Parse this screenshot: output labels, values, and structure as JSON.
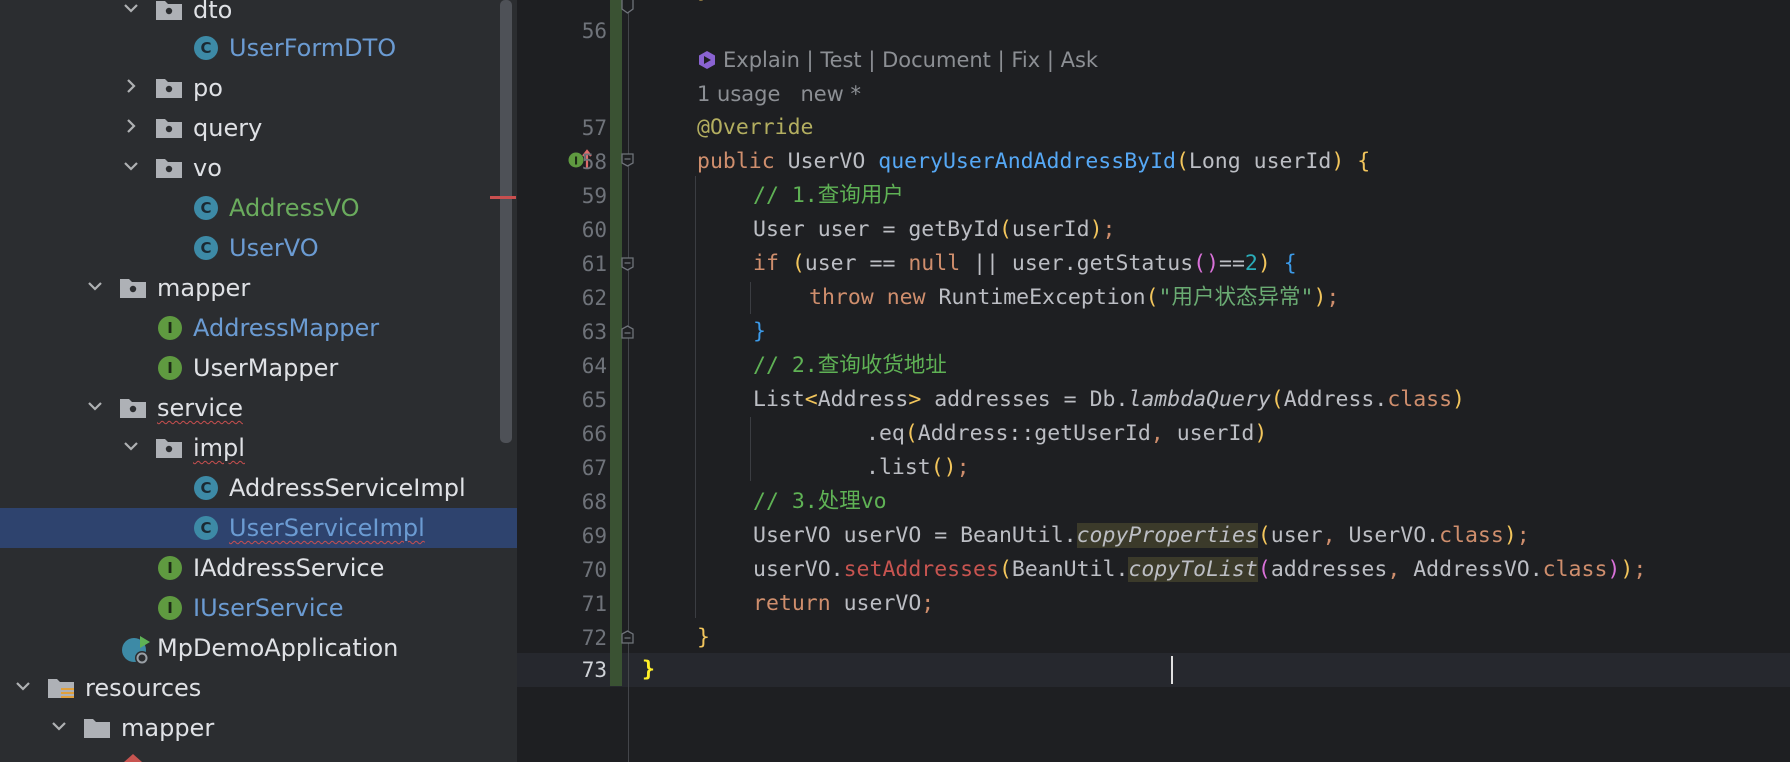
{
  "project_tree": {
    "items": [
      {
        "label": "dto",
        "kind": "package"
      },
      {
        "label": "UserFormDTO",
        "kind": "class"
      },
      {
        "label": "po",
        "kind": "package"
      },
      {
        "label": "query",
        "kind": "package"
      },
      {
        "label": "vo",
        "kind": "package"
      },
      {
        "label": "AddressVO",
        "kind": "class"
      },
      {
        "label": "UserVO",
        "kind": "class"
      },
      {
        "label": "mapper",
        "kind": "package"
      },
      {
        "label": "AddressMapper",
        "kind": "interface"
      },
      {
        "label": "UserMapper",
        "kind": "interface"
      },
      {
        "label": "service",
        "kind": "package"
      },
      {
        "label": "impl",
        "kind": "package"
      },
      {
        "label": "AddressServiceImpl",
        "kind": "class"
      },
      {
        "label": "UserServiceImpl",
        "kind": "class",
        "selected": true
      },
      {
        "label": "IAddressService",
        "kind": "interface"
      },
      {
        "label": "IUserService",
        "kind": "interface"
      },
      {
        "label": "MpDemoApplication",
        "kind": "spring-boot-class"
      },
      {
        "label": "resources",
        "kind": "resources-folder"
      },
      {
        "label": "mapper",
        "kind": "folder"
      }
    ],
    "icons": {
      "class": "C",
      "interface": "I"
    }
  },
  "editor": {
    "line_numbers": [
      "56",
      "57",
      "58",
      "59",
      "60",
      "61",
      "62",
      "63",
      "64",
      "65",
      "66",
      "67",
      "68",
      "69",
      "70",
      "71",
      "72",
      "73"
    ],
    "current_line": "73",
    "inlay_actions": [
      "Explain",
      "Test",
      "Document",
      "Fix",
      "Ask"
    ],
    "inlay_separator": " | ",
    "usage_hint": "1 usage",
    "author_hint": "new *",
    "code": {
      "l57": [
        "@Override"
      ],
      "l58": [
        "public",
        "UserVO",
        "queryUserAndAddressById",
        "Long",
        "userId"
      ],
      "l59": [
        "// 1.查询用户"
      ],
      "l60": [
        "User user = ",
        "getById",
        "userId"
      ],
      "l61": [
        "if",
        "user == ",
        "null",
        " || user.",
        "getStatus",
        "==",
        "2"
      ],
      "l62": [
        "throw",
        "new",
        "RuntimeException",
        "\"用户状态异常\""
      ],
      "l64": [
        "// 2.查询收货地址"
      ],
      "l65": [
        "List",
        "Address",
        " addresses = Db.",
        "lambdaQuery",
        "Address.",
        "class"
      ],
      "l66": [
        ".eq",
        "Address::getUserId",
        "userId"
      ],
      "l67": [
        ".list"
      ],
      "l68": [
        "// 3.处理vo"
      ],
      "l69": [
        "UserVO userVO = BeanUtil.",
        "copyProperties",
        "user",
        "UserVO.",
        "class"
      ],
      "l70": [
        "userVO.",
        "setAddresses",
        "BeanUtil.",
        "copyToList",
        "addresses",
        "AddressVO.",
        "class"
      ],
      "l71": [
        "return",
        " userVO"
      ]
    }
  },
  "colors": {
    "tree_bg": "#2b2d30",
    "editor_bg": "#1e1f22",
    "selection": "#2e436e",
    "keyword": "#cf8e6d",
    "method": "#56a8f5",
    "comment": "#5fb255",
    "string": "#6aab73",
    "annotation": "#b3ae60"
  }
}
